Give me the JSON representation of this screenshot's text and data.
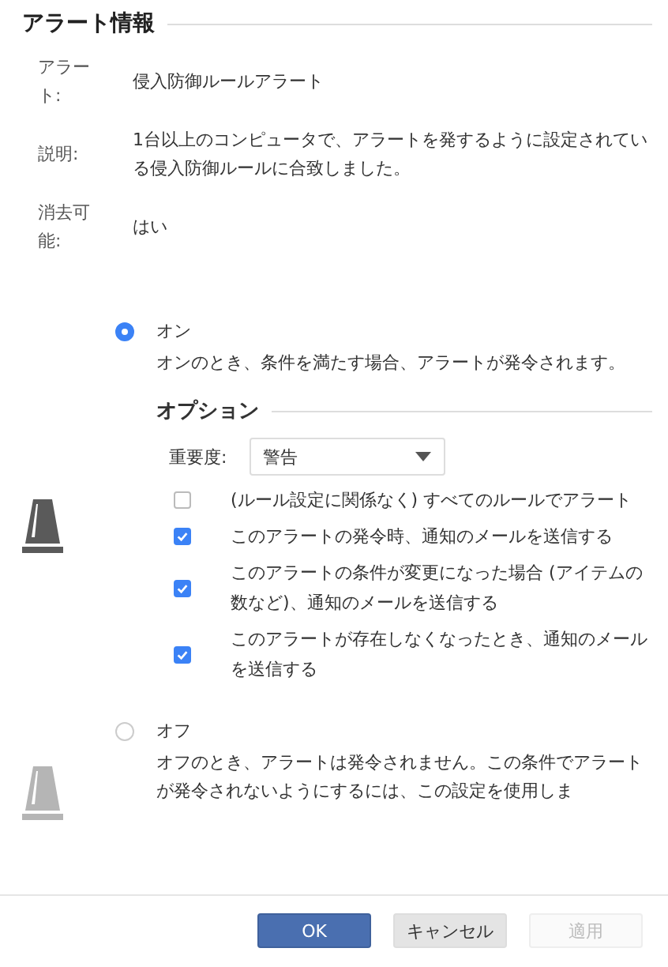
{
  "section_title": "アラート情報",
  "info": [
    {
      "label": "アラート:",
      "value": "侵入防御ルールアラート"
    },
    {
      "label": "説明:",
      "value": "1台以上のコンピュータで、アラートを発するように設定されている侵入防御ルールに合致しました。"
    },
    {
      "label": "消去可能:",
      "value": "はい"
    }
  ],
  "modes": [
    {
      "label": "オン",
      "selected": true,
      "description": "オンのとき、条件を満たす場合、アラートが発令されます。",
      "options": {
        "title": "オプション",
        "severity": {
          "label": "重要度:",
          "value": "警告"
        },
        "checkboxes": [
          {
            "label": "(ルール設定に関係なく) すべてのルールでアラート",
            "checked": false
          },
          {
            "label": "このアラートの発令時、通知のメールを送信する",
            "checked": true
          },
          {
            "label": "このアラートの条件が変更になった場合 (アイテムの数など)、通知のメールを送信する",
            "checked": true
          },
          {
            "label": "このアラートが存在しなくなったとき、通知のメールを送信する",
            "checked": true
          }
        ]
      }
    },
    {
      "label": "オフ",
      "selected": false,
      "description": "オフのとき、アラートは発令されません。この条件でアラートが発令されないようにするには、この設定を使用しま"
    }
  ],
  "buttons": [
    {
      "label": "OK",
      "kind": "primary",
      "disabled": false
    },
    {
      "label": "キャンセル",
      "kind": "secondary",
      "disabled": false
    },
    {
      "label": "適用",
      "kind": "secondary",
      "disabled": true
    }
  ]
}
